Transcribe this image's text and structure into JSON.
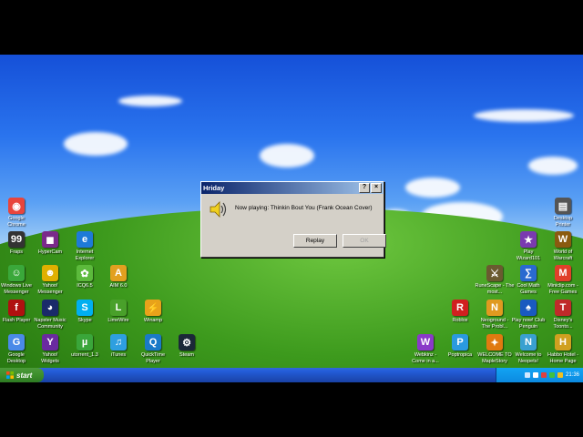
{
  "dialog": {
    "title": "Hriday",
    "help_glyph": "?",
    "close_glyph": "×",
    "message": "Now playing: Thinkin Bout You (Frank Ocean Cover)",
    "replay_label": "Replay",
    "ok_label": "OK"
  },
  "taskbar": {
    "start_label": "start",
    "clock": "21:36"
  },
  "icons_left": [
    {
      "label": "Google\nChrome",
      "icon": "chrome-icon",
      "color": "#e8453c",
      "glyph": "◉"
    },
    {
      "label": "Fraps",
      "icon": "fraps-icon",
      "color": "#333333",
      "glyph": "99"
    },
    {
      "label": "HyperCam",
      "icon": "hypercam-icon",
      "color": "#7a2a8a",
      "glyph": "◼"
    },
    {
      "label": "Internet\nExplorer",
      "icon": "ie-icon",
      "color": "#1e7ad8",
      "glyph": "e"
    },
    {
      "label": "Windows Live\nMessenger",
      "icon": "msn-icon",
      "color": "#3aa83a",
      "glyph": "☺"
    },
    {
      "label": "Yahoo!\nMessenger",
      "icon": "yahoo-messenger-icon",
      "color": "#e0b000",
      "glyph": "☻"
    },
    {
      "label": "ICQ6.5",
      "icon": "icq-icon",
      "color": "#5cba3c",
      "glyph": "✿"
    },
    {
      "label": "AIM 6.0",
      "icon": "aim-icon",
      "color": "#e2a020",
      "glyph": "A"
    },
    {
      "label": "Flash Player",
      "icon": "flash-icon",
      "color": "#b01010",
      "glyph": "f"
    },
    {
      "label": "Napster Music\nCommunity",
      "icon": "napster-icon",
      "color": "#1a2a6a",
      "glyph": "◕"
    },
    {
      "label": "Skype",
      "icon": "skype-icon",
      "color": "#00aff0",
      "glyph": "S"
    },
    {
      "label": "LimeWire",
      "icon": "limewire-icon",
      "color": "#49a02a",
      "glyph": "L"
    },
    {
      "label": "Winamp",
      "icon": "winamp-icon",
      "color": "#e8a21a",
      "glyph": "⚡"
    },
    {
      "label": "Google\nDesktop",
      "icon": "google-desktop-icon",
      "color": "#4a8ae8",
      "glyph": "G"
    },
    {
      "label": "Yahoo!\nWidgets",
      "icon": "yahoo-widgets-icon",
      "color": "#6a2aa0",
      "glyph": "Y"
    },
    {
      "label": "utorrent_1.3",
      "icon": "utorrent-icon",
      "color": "#3aa63a",
      "glyph": "µ"
    },
    {
      "label": "iTunes",
      "icon": "itunes-icon",
      "color": "#2e9fe0",
      "glyph": "♫"
    },
    {
      "label": "QuickTime\nPlayer",
      "icon": "quicktime-icon",
      "color": "#1a7ac8",
      "glyph": "Q"
    },
    {
      "label": "Steam",
      "icon": "steam-icon",
      "color": "#1b2838",
      "glyph": "⚙"
    }
  ],
  "icons_right": [
    {
      "label": "Desktop\nPrinter",
      "icon": "printer-icon",
      "color": "#555555",
      "glyph": "▤"
    },
    {
      "label": "Play\nWizard101",
      "icon": "wizard101-icon",
      "color": "#7a3ab0",
      "glyph": "★"
    },
    {
      "label": "World of\nWarcraft",
      "icon": "wow-icon",
      "color": "#8a5a10",
      "glyph": "W"
    },
    {
      "label": "RuneScape - The most...",
      "icon": "runescape-icon",
      "color": "#6a5a30",
      "glyph": "⚔"
    },
    {
      "label": "Cool Math\nGames",
      "icon": "coolmath-icon",
      "color": "#2a6ad0",
      "glyph": "∑"
    },
    {
      "label": "Miniclip.com -\nFree Games",
      "icon": "miniclip-icon",
      "color": "#e0402a",
      "glyph": "M"
    },
    {
      "label": "Roblox",
      "icon": "roblox-icon",
      "color": "#d02020",
      "glyph": "R"
    },
    {
      "label": "Neoground -\nThe Probl...",
      "icon": "neoground-icon",
      "color": "#e09a20",
      "glyph": "N"
    },
    {
      "label": "Play now! Club\nPenguin",
      "icon": "clubpenguin-icon",
      "color": "#1a5ac0",
      "glyph": "♠"
    },
    {
      "label": "Disney's\nToonto...",
      "icon": "toontown-icon",
      "color": "#c02a2a",
      "glyph": "T"
    },
    {
      "label": "Webkinz -\nCome in a...",
      "icon": "webkinz-icon",
      "color": "#8a3ac8",
      "glyph": "W"
    },
    {
      "label": "Poptropica",
      "icon": "poptropica-icon",
      "color": "#2a9ae0",
      "glyph": "P"
    },
    {
      "label": "WELCOME TO\nMapleStory",
      "icon": "maplestory-icon",
      "color": "#e07a10",
      "glyph": "✦"
    },
    {
      "label": "Welcome to\nNeopets!",
      "icon": "neopets-icon",
      "color": "#3aa0d0",
      "glyph": "N"
    },
    {
      "label": "Habbo Hotel -\nHome Page",
      "icon": "habbo-icon",
      "color": "#d0a020",
      "glyph": "H"
    }
  ]
}
